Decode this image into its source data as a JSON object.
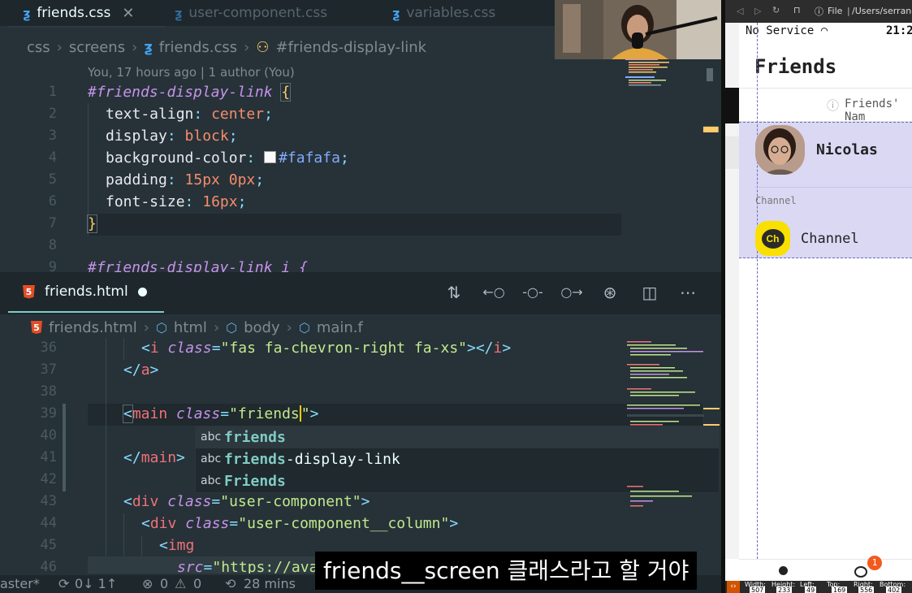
{
  "top_tabs": [
    {
      "label": "friends.css",
      "active": true
    },
    {
      "label": "user-component.css",
      "active": false
    },
    {
      "label": "variables.css",
      "active": false
    }
  ],
  "breadcrumb_css": [
    "css",
    "screens",
    "friends.css",
    "#friends-display-link"
  ],
  "blame": "You, 17 hours ago | 1 author (You)",
  "css_code": {
    "selector": "#friends-display-link",
    "open": "{",
    "decls": [
      {
        "prop": "text-align",
        "value": "center"
      },
      {
        "prop": "display",
        "value": "block"
      },
      {
        "prop": "background-color",
        "value": "#fafafa"
      },
      {
        "prop": "padding",
        "value": "15px 0px"
      },
      {
        "prop": "font-size",
        "value": "16px"
      }
    ],
    "close": "}",
    "next_selector": "#friends-display-link i {"
  },
  "css_line_numbers": [
    "1",
    "2",
    "3",
    "4",
    "5",
    "6",
    "7",
    "8",
    "9"
  ],
  "bottom_tab": {
    "label": "friends.html",
    "badge": "5"
  },
  "toolbar_icons": [
    "compare-changes-icon",
    "git-previous-icon",
    "git-commit-icon",
    "git-next-icon",
    "git-history-icon",
    "split-editor-icon",
    "more-actions-icon"
  ],
  "toolbar_glyphs": [
    "⇅",
    "←○",
    "-○-",
    "○→",
    "⊛",
    "◫",
    "⋯"
  ],
  "breadcrumb_html": [
    "friends.html",
    "html",
    "body",
    "main.f"
  ],
  "html_line_numbers": [
    "36",
    "37",
    "38",
    "39",
    "40",
    "41",
    "42",
    "43",
    "44",
    "45",
    "46"
  ],
  "html_code": {
    "l36": {
      "open": "<",
      "tag": "i",
      "attr": "class",
      "eq": "=",
      "val": "\"fas fa-chevron-right fa-xs\"",
      "close": "></",
      "tag2": "i",
      "end": ">"
    },
    "l37": {
      "open": "</",
      "tag": "a",
      "end": ">"
    },
    "l39": {
      "open": "<",
      "tag": "main",
      "attr": "class",
      "eq": "=",
      "val": "\"friends",
      "val2": "\"",
      "end": ">"
    },
    "l41": {
      "open": "</",
      "tag": "main",
      "end": ">"
    },
    "l43": {
      "open": "<",
      "tag": "div",
      "attr": "class",
      "eq": "=",
      "val": "\"user-component\"",
      "end": ">"
    },
    "l44": {
      "open": "<",
      "tag": "div",
      "attr": "class",
      "eq": "=",
      "val": "\"user-component__column\"",
      "end": ">"
    },
    "l45": {
      "open": "<",
      "tag": "img"
    },
    "l46": {
      "attr": "src",
      "eq": "=",
      "val": "\"https://ava"
    }
  },
  "suggestions": [
    {
      "kind": "abc",
      "match": "friends",
      "rest": ""
    },
    {
      "kind": "abc",
      "match": "friends",
      "rest": "-display-link"
    },
    {
      "kind": "abc",
      "match": "Friends",
      "rest": ""
    }
  ],
  "status_bar": {
    "branch": "aster*",
    "sync": "0↓ 1↑",
    "errors": "0",
    "warnings": "0",
    "time": "28 mins"
  },
  "subtitle": "friends__screen 클래스라고 할 거야",
  "browser": {
    "file_label": "File",
    "path": "/Users/serrano",
    "carrier": "No Service",
    "clock": "21:2",
    "title": "Friends",
    "friends_button": "Friends' Nam",
    "user_name": "Nicolas",
    "channel_section": "Channel",
    "channel_icon": "Ch",
    "channel_name": "Channel",
    "tab_badge": "1",
    "box_labels": [
      "Width:",
      "Height:",
      "Left:",
      "Top:",
      "Right:",
      "Bottom:"
    ],
    "box_values": [
      "507",
      "233",
      "49",
      "169",
      "556",
      "402"
    ]
  },
  "colors": {
    "editor_bg": "#263238",
    "accent_teal": "#80cbc4",
    "highlight_purple": "#dad8f3",
    "channel_yellow": "#f9e000"
  }
}
